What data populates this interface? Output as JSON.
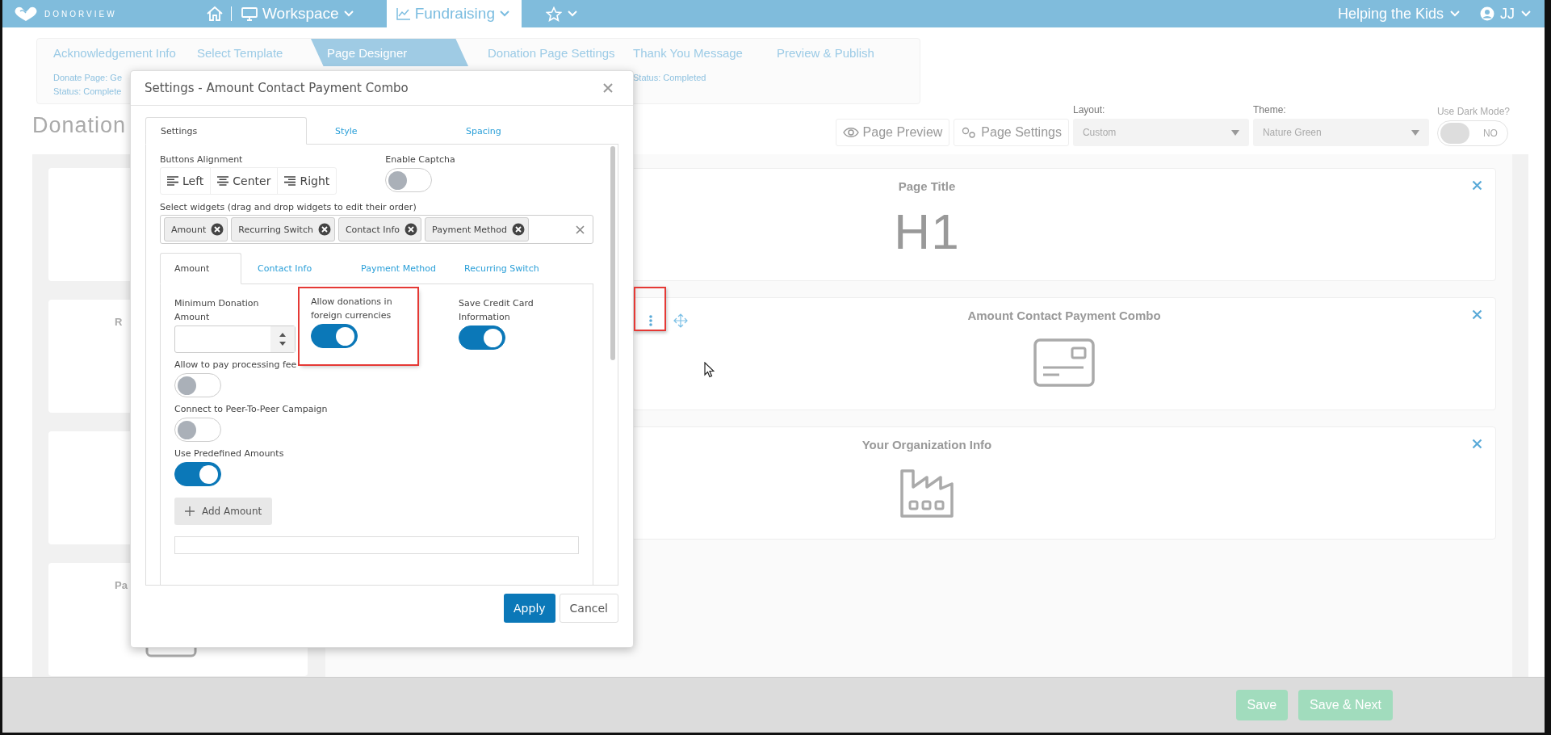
{
  "topbar": {
    "brand": "DONORVIEW",
    "nav": [
      {
        "label": "Workspace",
        "selected": false
      },
      {
        "label": "Fundraising",
        "selected": true
      }
    ],
    "organization": "Helping the Kids",
    "user": "JJ"
  },
  "steps": [
    {
      "label": "Acknowledgement Info",
      "selected": false,
      "lines": [
        "Donate Page: Ge",
        "Status: Complete"
      ]
    },
    {
      "label": "Select Template",
      "selected": false
    },
    {
      "label": "Page Designer",
      "selected": true
    },
    {
      "label": "Donation Page Settings",
      "selected": false
    },
    {
      "label": "Thank You Message",
      "selected": false,
      "lines": [
        "Status: Completed"
      ]
    },
    {
      "label": "Preview & Publish",
      "selected": false
    }
  ],
  "page_heading": "Donation",
  "toolbar": {
    "buttons": [
      {
        "label": "Page Preview",
        "kind": "preview"
      },
      {
        "label": "Page Settings",
        "kind": "settings"
      }
    ],
    "layout": {
      "label": "Layout:",
      "value": "Custom"
    },
    "theme": {
      "label": "Theme:",
      "value": "Nature Green"
    },
    "dark_mode": {
      "label": "Use Dark Mode?",
      "on": false,
      "text": "NO"
    }
  },
  "side_widgets": [
    {
      "kind": "blank"
    },
    {
      "kind": "titled",
      "label": "R"
    },
    {
      "kind": "blank"
    },
    {
      "kind": "payment",
      "label": "Pa"
    }
  ],
  "widgets": [
    {
      "title": "Page Title",
      "kind": "heading",
      "preview": "H1",
      "selected": false,
      "highlighted": false
    },
    {
      "title": "Amount Contact Payment Combo",
      "kind": "payment",
      "selected": true,
      "highlighted": true
    },
    {
      "title": "Your Organization Info",
      "kind": "organization",
      "selected": false,
      "highlighted": false
    }
  ],
  "modal": {
    "title": "Settings - Amount Contact Payment Combo",
    "tabs": [
      {
        "label": "Settings",
        "selected": true
      },
      {
        "label": "Style",
        "selected": false
      },
      {
        "label": "Spacing",
        "selected": false
      }
    ],
    "alignment": {
      "label": "Buttons Alignment",
      "options": [
        {
          "label": "Left",
          "kind": "left",
          "selected": false
        },
        {
          "label": "Center",
          "kind": "center",
          "selected": false
        },
        {
          "label": "Right",
          "kind": "right",
          "selected": false
        }
      ]
    },
    "captcha": {
      "label": "Enable Captcha",
      "on": false
    },
    "widgets_field": {
      "label": "Select widgets (drag and drop widgets to edit their order)",
      "tags": [
        "Amount",
        "Recurring Switch",
        "Contact Info",
        "Payment Method"
      ]
    },
    "sub_tabs": [
      {
        "label": "Amount",
        "selected": true
      },
      {
        "label": "Contact Info",
        "selected": false
      },
      {
        "label": "Payment Method",
        "selected": false
      },
      {
        "label": "Recurring Switch",
        "selected": false
      }
    ],
    "fields": [
      {
        "kind": "number",
        "label": "Minimum Donation Amount",
        "highlighted": false
      },
      {
        "kind": "toggle",
        "label": "Allow donations in foreign currencies",
        "on": true,
        "highlighted": true
      },
      {
        "kind": "toggle",
        "label": "Save Credit Card Information",
        "on": true,
        "highlighted": false
      },
      {
        "kind": "toggle",
        "label": "Allow to pay processing fee",
        "on": false,
        "highlighted": false
      },
      {
        "kind": "toggle",
        "label": "Connect to Peer-To-Peer Campaign",
        "on": false,
        "highlighted": false
      },
      {
        "kind": "toggle",
        "label": "Use Predefined Amounts",
        "on": true,
        "highlighted": false
      }
    ],
    "add_button": "Add Amount",
    "buttons": [
      {
        "label": "Apply",
        "kind": "primary"
      },
      {
        "label": "Cancel",
        "kind": "secondary"
      }
    ]
  },
  "footer_buttons": [
    "Save",
    "Save & Next"
  ]
}
